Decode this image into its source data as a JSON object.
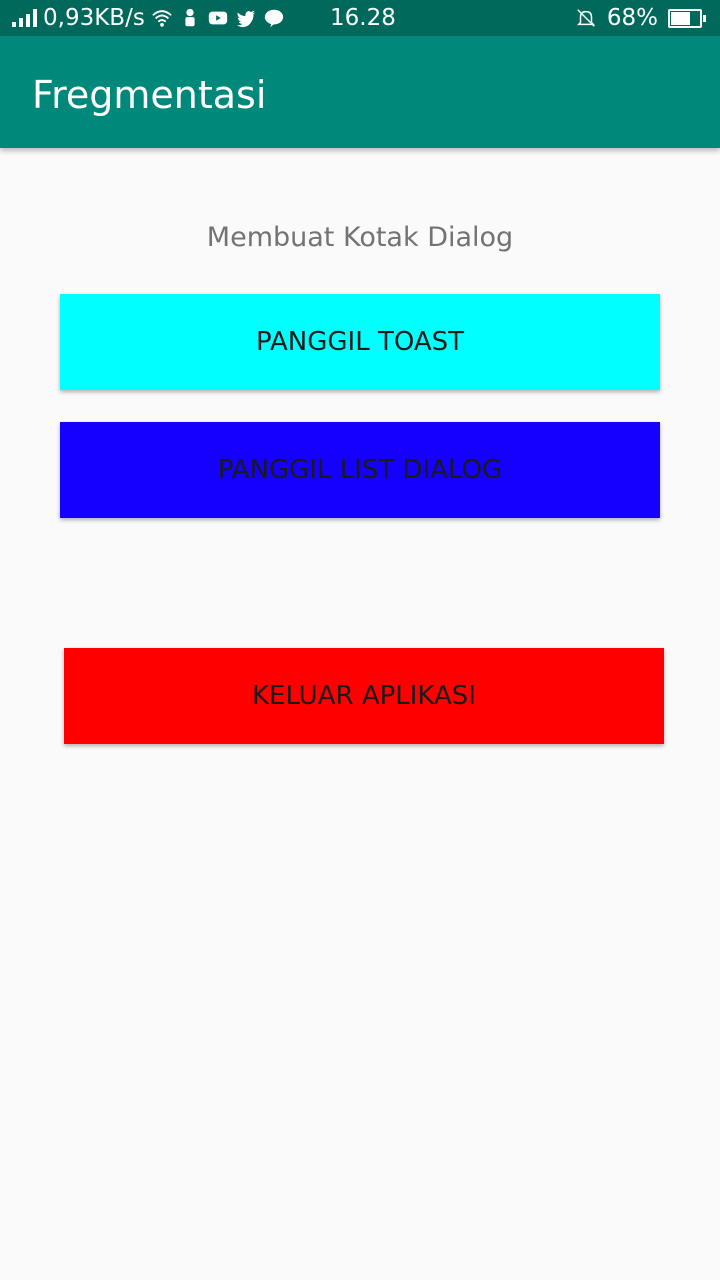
{
  "status_bar": {
    "network_speed": "0,93KB/s",
    "time": "16.28",
    "battery_percent": "68%",
    "battery_level": 0.68,
    "icons": [
      "signal-icon",
      "wifi-icon",
      "notification-icon",
      "youtube-icon",
      "twitter-icon",
      "line-icon",
      "silent-bell-icon",
      "battery-icon"
    ]
  },
  "app_bar": {
    "title": "Fregmentasi",
    "color": "#00897b"
  },
  "main": {
    "subtitle": "Membuat Kotak Dialog",
    "buttons": [
      {
        "label": "PANGGIL TOAST",
        "color": "#00ffff"
      },
      {
        "label": "PANGGIL LIST DIALOG",
        "color": "#1500ff"
      },
      {
        "label": "KELUAR APLIKASI",
        "color": "#ff0000"
      }
    ]
  }
}
